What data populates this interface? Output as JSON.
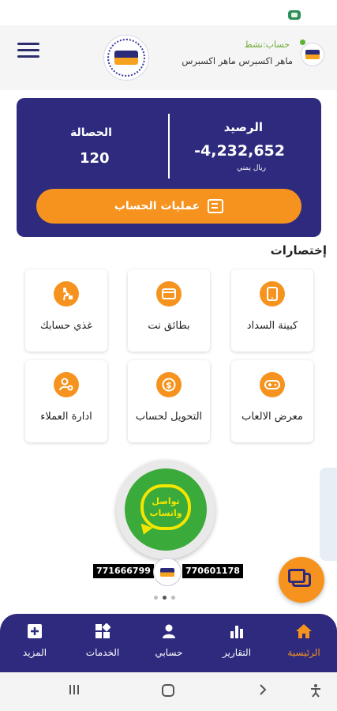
{
  "header": {
    "account_status": "حساب:نشط",
    "account_name": "ماهر اكسبرس ماهر اكسبرس"
  },
  "balance_card": {
    "balance_label": "الرصيد",
    "balance_value": "-4,232,652",
    "currency": "ريال يمني",
    "collection_label": "الحصالة",
    "collection_value": "120",
    "operations_button": "عمليات الحساب"
  },
  "shortcuts": {
    "title": "إختصارات",
    "items": [
      {
        "label": "كبينة السداد",
        "icon": "phone-icon"
      },
      {
        "label": "بطائق نت",
        "icon": "card-icon"
      },
      {
        "label": "غذي حسابك",
        "icon": "delivery-icon"
      },
      {
        "label": "معرض الالعاب",
        "icon": "gamepad-icon"
      },
      {
        "label": "التحويل لحساب",
        "icon": "dollar-coin-icon"
      },
      {
        "label": "ادارة العملاء",
        "icon": "user-settings-icon"
      }
    ]
  },
  "banner": {
    "whatsapp_line1": "تواصل",
    "whatsapp_line2": "واتساب",
    "phone_left": "771666799",
    "phone_right": "770601178"
  },
  "bottom_nav": {
    "items": [
      {
        "label": "الرئيسية",
        "icon": "home-icon",
        "active": true
      },
      {
        "label": "التقارير",
        "icon": "bar-chart-icon",
        "active": false
      },
      {
        "label": "حسابي",
        "icon": "person-icon",
        "active": false
      },
      {
        "label": "الخدمات",
        "icon": "grid-icon",
        "active": false
      },
      {
        "label": "المزيد",
        "icon": "plus-box-icon",
        "active": false
      }
    ]
  },
  "colors": {
    "primary": "#2e2a7e",
    "accent": "#f6931e",
    "online": "#5ab533"
  }
}
